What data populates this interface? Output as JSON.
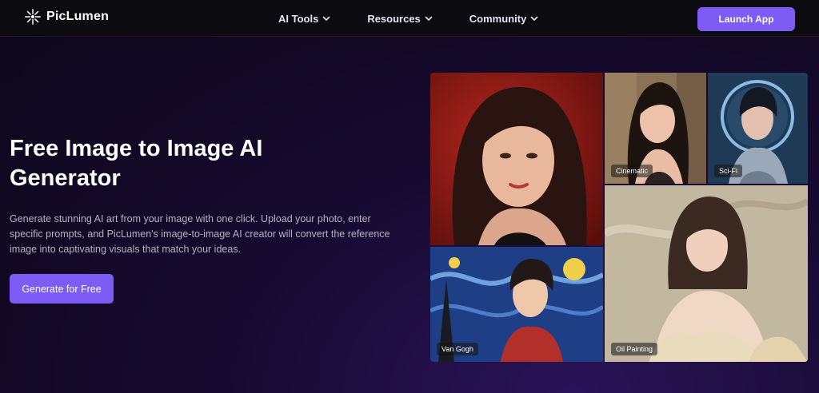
{
  "nav": {
    "brand": "PicLumen",
    "menu": [
      {
        "label": "AI Tools"
      },
      {
        "label": "Resources"
      },
      {
        "label": "Community"
      }
    ],
    "launch_label": "Launch App"
  },
  "hero": {
    "title_line1": "Free Image to Image AI",
    "title_line2": "Generator",
    "description": "Generate stunning AI art from your image with one click. Upload your photo, enter specific prompts, and PicLumen's image-to-image AI creator will convert the reference image into captivating visuals that match your ideas.",
    "cta_label": "Generate for Free"
  },
  "gallery": {
    "tiles": [
      {
        "style": ""
      },
      {
        "style": "Cinematic"
      },
      {
        "style": "Sci-Fi"
      },
      {
        "style": "Van Gogh"
      },
      {
        "style": "Oil Painting"
      }
    ]
  },
  "colors": {
    "accent": "#7c5cf5",
    "navbar_bg": "#0b0b10",
    "page_bg": "#160a2f",
    "body_text": "#b5b1c6"
  },
  "icons": {
    "brand": "sparkle-logo-icon",
    "dropdown": "chevron-down-icon"
  }
}
